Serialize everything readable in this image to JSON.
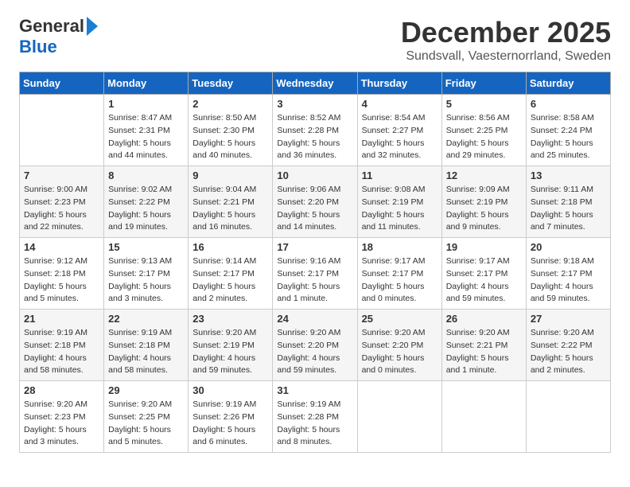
{
  "header": {
    "logo_general": "General",
    "logo_blue": "Blue",
    "month": "December 2025",
    "location": "Sundsvall, Vaesternorrland, Sweden"
  },
  "weekdays": [
    "Sunday",
    "Monday",
    "Tuesday",
    "Wednesday",
    "Thursday",
    "Friday",
    "Saturday"
  ],
  "weeks": [
    [
      {
        "day": "",
        "sunrise": "",
        "sunset": "",
        "daylight": ""
      },
      {
        "day": "1",
        "sunrise": "Sunrise: 8:47 AM",
        "sunset": "Sunset: 2:31 PM",
        "daylight": "Daylight: 5 hours and 44 minutes."
      },
      {
        "day": "2",
        "sunrise": "Sunrise: 8:50 AM",
        "sunset": "Sunset: 2:30 PM",
        "daylight": "Daylight: 5 hours and 40 minutes."
      },
      {
        "day": "3",
        "sunrise": "Sunrise: 8:52 AM",
        "sunset": "Sunset: 2:28 PM",
        "daylight": "Daylight: 5 hours and 36 minutes."
      },
      {
        "day": "4",
        "sunrise": "Sunrise: 8:54 AM",
        "sunset": "Sunset: 2:27 PM",
        "daylight": "Daylight: 5 hours and 32 minutes."
      },
      {
        "day": "5",
        "sunrise": "Sunrise: 8:56 AM",
        "sunset": "Sunset: 2:25 PM",
        "daylight": "Daylight: 5 hours and 29 minutes."
      },
      {
        "day": "6",
        "sunrise": "Sunrise: 8:58 AM",
        "sunset": "Sunset: 2:24 PM",
        "daylight": "Daylight: 5 hours and 25 minutes."
      }
    ],
    [
      {
        "day": "7",
        "sunrise": "Sunrise: 9:00 AM",
        "sunset": "Sunset: 2:23 PM",
        "daylight": "Daylight: 5 hours and 22 minutes."
      },
      {
        "day": "8",
        "sunrise": "Sunrise: 9:02 AM",
        "sunset": "Sunset: 2:22 PM",
        "daylight": "Daylight: 5 hours and 19 minutes."
      },
      {
        "day": "9",
        "sunrise": "Sunrise: 9:04 AM",
        "sunset": "Sunset: 2:21 PM",
        "daylight": "Daylight: 5 hours and 16 minutes."
      },
      {
        "day": "10",
        "sunrise": "Sunrise: 9:06 AM",
        "sunset": "Sunset: 2:20 PM",
        "daylight": "Daylight: 5 hours and 14 minutes."
      },
      {
        "day": "11",
        "sunrise": "Sunrise: 9:08 AM",
        "sunset": "Sunset: 2:19 PM",
        "daylight": "Daylight: 5 hours and 11 minutes."
      },
      {
        "day": "12",
        "sunrise": "Sunrise: 9:09 AM",
        "sunset": "Sunset: 2:19 PM",
        "daylight": "Daylight: 5 hours and 9 minutes."
      },
      {
        "day": "13",
        "sunrise": "Sunrise: 9:11 AM",
        "sunset": "Sunset: 2:18 PM",
        "daylight": "Daylight: 5 hours and 7 minutes."
      }
    ],
    [
      {
        "day": "14",
        "sunrise": "Sunrise: 9:12 AM",
        "sunset": "Sunset: 2:18 PM",
        "daylight": "Daylight: 5 hours and 5 minutes."
      },
      {
        "day": "15",
        "sunrise": "Sunrise: 9:13 AM",
        "sunset": "Sunset: 2:17 PM",
        "daylight": "Daylight: 5 hours and 3 minutes."
      },
      {
        "day": "16",
        "sunrise": "Sunrise: 9:14 AM",
        "sunset": "Sunset: 2:17 PM",
        "daylight": "Daylight: 5 hours and 2 minutes."
      },
      {
        "day": "17",
        "sunrise": "Sunrise: 9:16 AM",
        "sunset": "Sunset: 2:17 PM",
        "daylight": "Daylight: 5 hours and 1 minute."
      },
      {
        "day": "18",
        "sunrise": "Sunrise: 9:17 AM",
        "sunset": "Sunset: 2:17 PM",
        "daylight": "Daylight: 5 hours and 0 minutes."
      },
      {
        "day": "19",
        "sunrise": "Sunrise: 9:17 AM",
        "sunset": "Sunset: 2:17 PM",
        "daylight": "Daylight: 4 hours and 59 minutes."
      },
      {
        "day": "20",
        "sunrise": "Sunrise: 9:18 AM",
        "sunset": "Sunset: 2:17 PM",
        "daylight": "Daylight: 4 hours and 59 minutes."
      }
    ],
    [
      {
        "day": "21",
        "sunrise": "Sunrise: 9:19 AM",
        "sunset": "Sunset: 2:18 PM",
        "daylight": "Daylight: 4 hours and 58 minutes."
      },
      {
        "day": "22",
        "sunrise": "Sunrise: 9:19 AM",
        "sunset": "Sunset: 2:18 PM",
        "daylight": "Daylight: 4 hours and 58 minutes."
      },
      {
        "day": "23",
        "sunrise": "Sunrise: 9:20 AM",
        "sunset": "Sunset: 2:19 PM",
        "daylight": "Daylight: 4 hours and 59 minutes."
      },
      {
        "day": "24",
        "sunrise": "Sunrise: 9:20 AM",
        "sunset": "Sunset: 2:20 PM",
        "daylight": "Daylight: 4 hours and 59 minutes."
      },
      {
        "day": "25",
        "sunrise": "Sunrise: 9:20 AM",
        "sunset": "Sunset: 2:20 PM",
        "daylight": "Daylight: 5 hours and 0 minutes."
      },
      {
        "day": "26",
        "sunrise": "Sunrise: 9:20 AM",
        "sunset": "Sunset: 2:21 PM",
        "daylight": "Daylight: 5 hours and 1 minute."
      },
      {
        "day": "27",
        "sunrise": "Sunrise: 9:20 AM",
        "sunset": "Sunset: 2:22 PM",
        "daylight": "Daylight: 5 hours and 2 minutes."
      }
    ],
    [
      {
        "day": "28",
        "sunrise": "Sunrise: 9:20 AM",
        "sunset": "Sunset: 2:23 PM",
        "daylight": "Daylight: 5 hours and 3 minutes."
      },
      {
        "day": "29",
        "sunrise": "Sunrise: 9:20 AM",
        "sunset": "Sunset: 2:25 PM",
        "daylight": "Daylight: 5 hours and 5 minutes."
      },
      {
        "day": "30",
        "sunrise": "Sunrise: 9:19 AM",
        "sunset": "Sunset: 2:26 PM",
        "daylight": "Daylight: 5 hours and 6 minutes."
      },
      {
        "day": "31",
        "sunrise": "Sunrise: 9:19 AM",
        "sunset": "Sunset: 2:28 PM",
        "daylight": "Daylight: 5 hours and 8 minutes."
      },
      {
        "day": "",
        "sunrise": "",
        "sunset": "",
        "daylight": ""
      },
      {
        "day": "",
        "sunrise": "",
        "sunset": "",
        "daylight": ""
      },
      {
        "day": "",
        "sunrise": "",
        "sunset": "",
        "daylight": ""
      }
    ]
  ]
}
